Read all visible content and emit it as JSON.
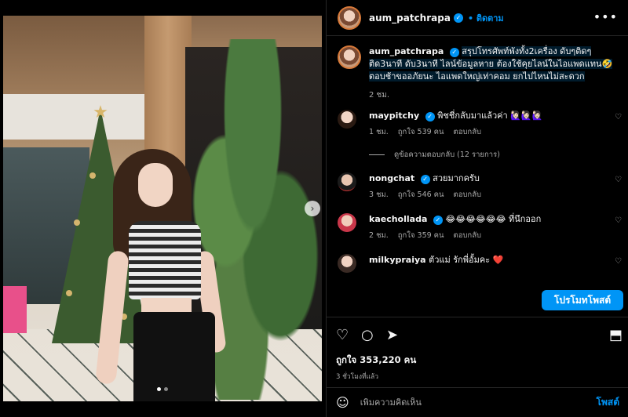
{
  "post": {
    "username": "aum_patchrapa",
    "follow_label": "ติดตาม",
    "more_icon": "•••",
    "caption": "สรุปโทรศัพท์พังทั้ง2เครื่อง ดับๆติดๆ ติด3นาที ดับ3นาที ไลน์ข้อมูลหาย ต้องใช้คุยไลน์ในไอแพดแทน🤣 ตอบช้าขออภัยนะ ไอแพดใหญ่เท่าคอม ยกไปไหนไม่สะดวก",
    "caption_time": "2 ชม."
  },
  "comments": [
    {
      "user": "maypitchy",
      "verified": true,
      "text": "พิชชี่กลับมาแล้วค่า 🙋🏻‍♀️🙋🏻‍♀️🙋🏻‍♀️",
      "time": "1 ชม.",
      "likes": "ถูกใจ 539 คน",
      "reply": "ตอบกลับ"
    },
    {
      "user": "nongchat",
      "verified": true,
      "text": "สวยมากครับ",
      "time": "3 ชม.",
      "likes": "ถูกใจ 546 คน",
      "reply": "ตอบกลับ"
    },
    {
      "user": "kaechollada",
      "verified": true,
      "text": "😂😂😂😂😂😂 ที่นึกออก",
      "time": "2 ชม.",
      "likes": "ถูกใจ 359 คน",
      "reply": "ตอบกลับ"
    },
    {
      "user": "milkypraiya",
      "verified": false,
      "text": "ตัวแม่ รักพี่อั้มคะ ❤️",
      "time": "",
      "likes": "",
      "reply": ""
    }
  ],
  "view_replies": "ดูข้อความตอบกลับ (12 รายการ)",
  "promote_label": "โปรโมทโพสต์",
  "likes_count": "ถูกใจ 353,220 คน",
  "posted_ago": "3 ชั่วโมงที่แล้ว",
  "comment_placeholder": "เพิ่มความคิดเห็น",
  "post_button": "โพสต์",
  "icons": {
    "heart": "♡",
    "comment": "○",
    "share": "➤",
    "bookmark": "⬒",
    "emoji": "☺",
    "chevron": "›"
  },
  "colors": {
    "accent": "#0095f6",
    "background": "#000000",
    "muted": "#a8a8a8"
  }
}
